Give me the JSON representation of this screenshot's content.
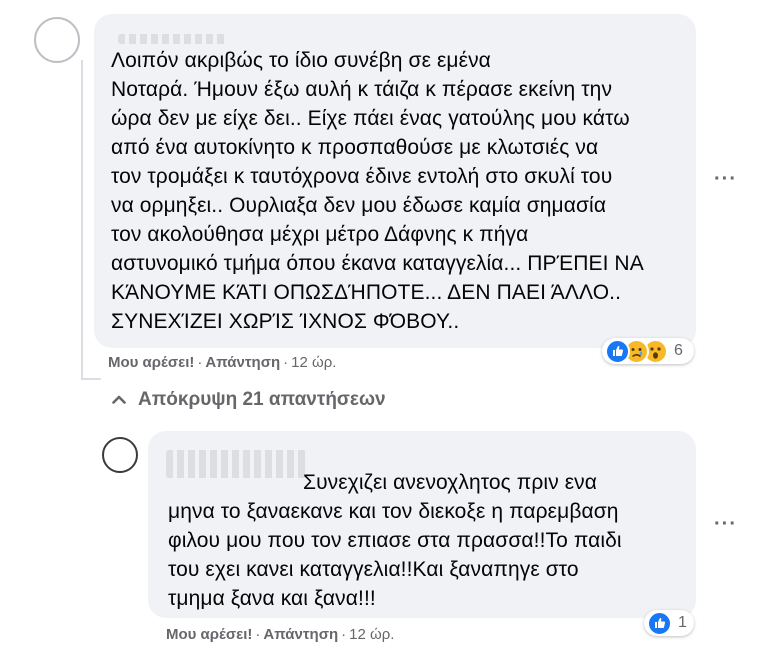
{
  "comment": {
    "text": "Λοιπόν ακριβώς το ίδιο συνέβη σε εμένα \nΝοταρά. Ήμουν έξω αυλή κ τάιζα κ πέρασε εκείνη την\nώρα δεν με είχε δει.. Είχε πάει ένας γατούλης μου κάτω\nαπό ένα αυτοκίνητο κ προσπαθούσε με κλωτσιές να\nτον τρομάξει κ ταυτόχρονα έδινε εντολή στο σκυλί του\nνα ορμηξει.. Ουρλιαξα δεν μου έδωσε καμία σημασία\nτον ακολούθησα μέχρι μέτρο Δάφνης κ πήγα\nαστυνομικό τμήμα όπου έκανα καταγγελία... ΠΡΈΠΕΙ ΝΑ\nΚΆΝΟΥΜΕ ΚΆΤΙ ΟΠΩΣΔΉΠΟΤΕ... ΔΕΝ ΠΑΕΙ ΆΛΛΟ..\nΣΥΝΕΧΊΖΕΙ ΧΩΡΊΣ ΊΧΝΟΣ ΦΌΒΟΥ..",
    "like_label": "Μου αρέσει!",
    "reply_label": "Απάντηση",
    "separator": "·",
    "time": "12 ώρ.",
    "reaction_count": "6",
    "reactions": [
      "like",
      "sad",
      "wow"
    ],
    "more_label": "···"
  },
  "hide_replies_label": "Απόκρυψη 21 απαντήσεων",
  "hide_replies_icon": "chevron-up-icon",
  "reply": {
    "text": "Συνεχιζει ανενοχλητος πριν ενα\nμηνα το ξαναεκανε και τον διεκοξε η παρεμβαση\nφιλου μου που τον επιασε στα πρασσα!!Το παιδι\nτου εχει κανει καταγγελια!!Και ξαναπηγε στο\nτμημα ξανα και ξανα!!!",
    "like_label": "Μου αρέσει!",
    "reply_label": "Απάντηση",
    "separator": "·",
    "time": "12 ώρ.",
    "reaction_count": "1",
    "reactions": [
      "like"
    ],
    "more_label": "···"
  },
  "colors": {
    "bubble": "#f0f2f5",
    "secondary_text": "#65676b",
    "like_blue": "#1877f2",
    "emoji_yellow": "#f7b928"
  }
}
